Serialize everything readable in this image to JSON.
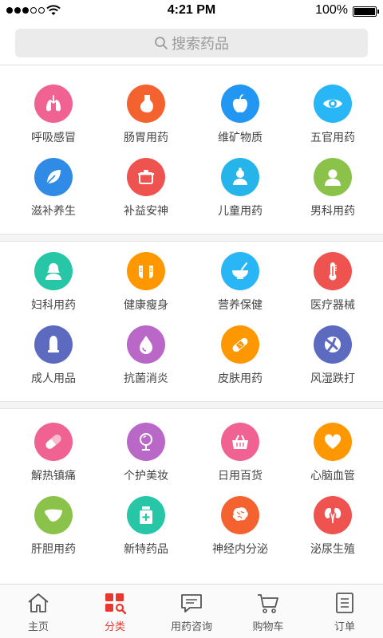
{
  "status": {
    "time": "4:21 PM",
    "battery": "100%"
  },
  "search": {
    "placeholder": "搜索药品"
  },
  "sections": [
    {
      "items": [
        {
          "label": "呼吸感冒",
          "icon": "lungs-icon",
          "color": "#f06292"
        },
        {
          "label": "肠胃用药",
          "icon": "stomach-icon",
          "color": "#f4622f"
        },
        {
          "label": "维矿物质",
          "icon": "apple-icon",
          "color": "#2196f3"
        },
        {
          "label": "五官用药",
          "icon": "eye-icon",
          "color": "#29b6f6"
        },
        {
          "label": "滋补养生",
          "icon": "leaf-icon",
          "color": "#2f8be6"
        },
        {
          "label": "补益安神",
          "icon": "pot-icon",
          "color": "#ef5350"
        },
        {
          "label": "儿童用药",
          "icon": "child-icon",
          "color": "#26b5ea"
        },
        {
          "label": "男科用药",
          "icon": "male-icon",
          "color": "#8bc34a"
        }
      ]
    },
    {
      "items": [
        {
          "label": "妇科用药",
          "icon": "female-icon",
          "color": "#26c6a6"
        },
        {
          "label": "健康瘦身",
          "icon": "fitness-icon",
          "color": "#ff9800"
        },
        {
          "label": "营养保健",
          "icon": "bowl-icon",
          "color": "#29b6f6"
        },
        {
          "label": "医疗器械",
          "icon": "thermometer-icon",
          "color": "#ef5350"
        },
        {
          "label": "成人用品",
          "icon": "condom-icon",
          "color": "#5c6bc0"
        },
        {
          "label": "抗菌消炎",
          "icon": "drop-icon",
          "color": "#ba68c8"
        },
        {
          "label": "皮肤用药",
          "icon": "bandage-icon",
          "color": "#ff9800"
        },
        {
          "label": "风湿跌打",
          "icon": "joint-icon",
          "color": "#5c6bc0"
        }
      ]
    },
    {
      "items": [
        {
          "label": "解热镇痛",
          "icon": "capsule-icon",
          "color": "#f06292"
        },
        {
          "label": "个护美妆",
          "icon": "mirror-icon",
          "color": "#ba68c8"
        },
        {
          "label": "日用百货",
          "icon": "basket-icon",
          "color": "#f06292"
        },
        {
          "label": "心脑血管",
          "icon": "heart-icon",
          "color": "#ff9800"
        },
        {
          "label": "肝胆用药",
          "icon": "liver-icon",
          "color": "#8bc34a"
        },
        {
          "label": "新特药品",
          "icon": "medicine-bottle-icon",
          "color": "#26c6a6"
        },
        {
          "label": "神经内分泌",
          "icon": "brain-icon",
          "color": "#f4622f"
        },
        {
          "label": "泌尿生殖",
          "icon": "kidney-icon",
          "color": "#ef5350"
        }
      ]
    }
  ],
  "tabs": [
    {
      "label": "主页",
      "icon": "home-icon",
      "active": false
    },
    {
      "label": "分类",
      "icon": "category-icon",
      "active": true
    },
    {
      "label": "用药咨询",
      "icon": "chat-icon",
      "active": false
    },
    {
      "label": "购物车",
      "icon": "cart-icon",
      "active": false
    },
    {
      "label": "订单",
      "icon": "order-icon",
      "active": false
    }
  ],
  "colors": {
    "accent": "#e8382f"
  }
}
